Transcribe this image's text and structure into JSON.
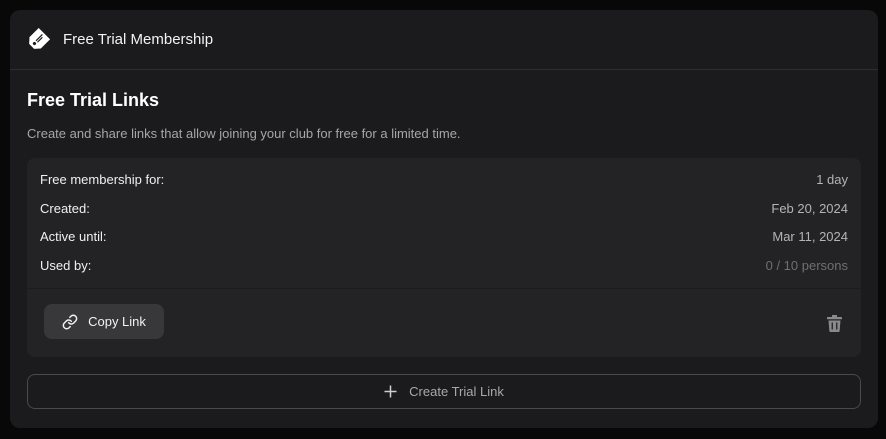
{
  "header": {
    "title": "Free Trial Membership",
    "icon": "price-tag-icon"
  },
  "section": {
    "title": "Free Trial Links",
    "description": "Create and share links that allow joining your club for free for a limited time."
  },
  "trial_link": {
    "rows": [
      {
        "label": "Free membership for:",
        "value": "1 day"
      },
      {
        "label": "Created:",
        "value": "Feb 20, 2024"
      },
      {
        "label": "Active until:",
        "value": "Mar 11, 2024"
      },
      {
        "label": "Used by:",
        "value": "0 / 10 persons"
      }
    ],
    "copy_label": "Copy Link",
    "copy_icon": "link-icon",
    "delete_icon": "trash-icon"
  },
  "create": {
    "label": "Create Trial Link",
    "icon": "plus-icon"
  },
  "colors": {
    "page_bg": "#080808",
    "card_bg": "#1b1b1d",
    "link_box_bg": "#232325",
    "button_bg": "#38383b"
  }
}
